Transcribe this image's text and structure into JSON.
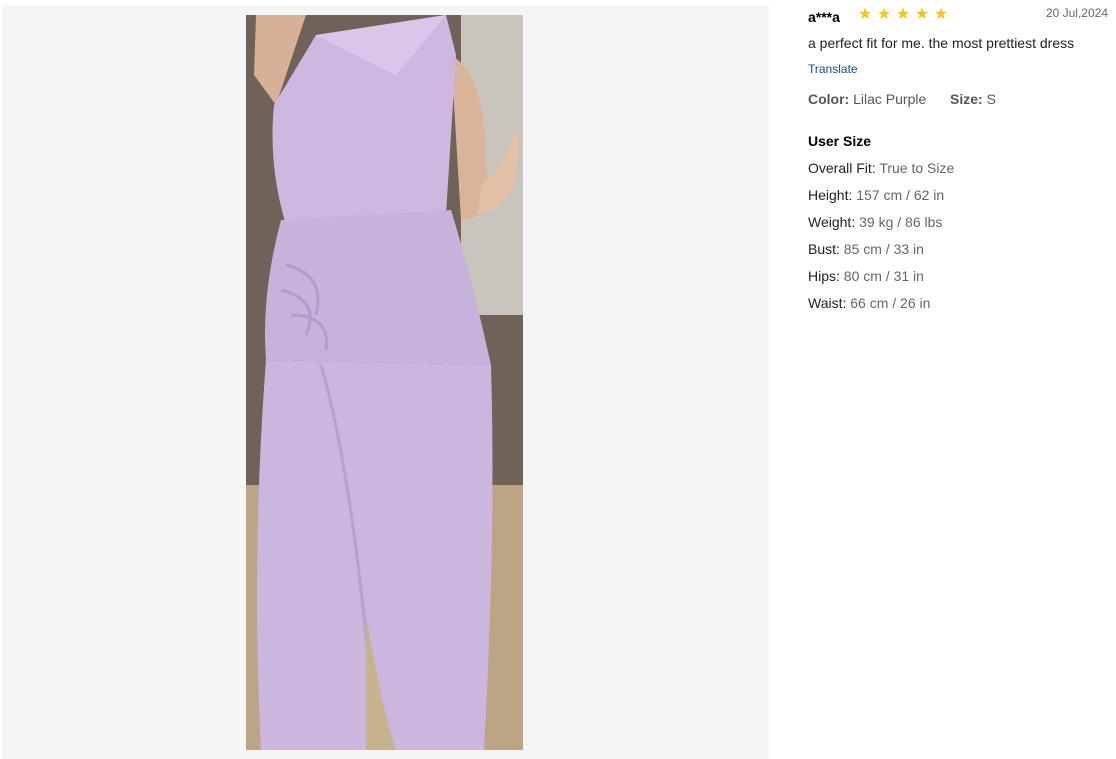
{
  "review": {
    "user": "a***a",
    "rating": 5,
    "star_glyph": "★",
    "date": "20 Jul,2024",
    "text": "a perfect fit for me. the most prettiest dress",
    "translate_label": "Translate",
    "color_key": "Color:",
    "color_value": "Lilac Purple",
    "size_key": "Size:",
    "size_value": "S"
  },
  "user_size": {
    "title": "User Size",
    "rows": [
      {
        "key": "Overall Fit:",
        "value": "True to Size"
      },
      {
        "key": "Height:",
        "value": "157 cm / 62 in"
      },
      {
        "key": "Weight:",
        "value": "39 kg / 86 lbs"
      },
      {
        "key": "Bust:",
        "value": "85 cm / 33 in"
      },
      {
        "key": "Hips:",
        "value": "80 cm / 31 in"
      },
      {
        "key": "Waist:",
        "value": "66 cm / 26 in"
      }
    ]
  },
  "colors": {
    "star": "#f5c518",
    "dress": "#cdb9e0",
    "link": "#1a4a8a"
  }
}
